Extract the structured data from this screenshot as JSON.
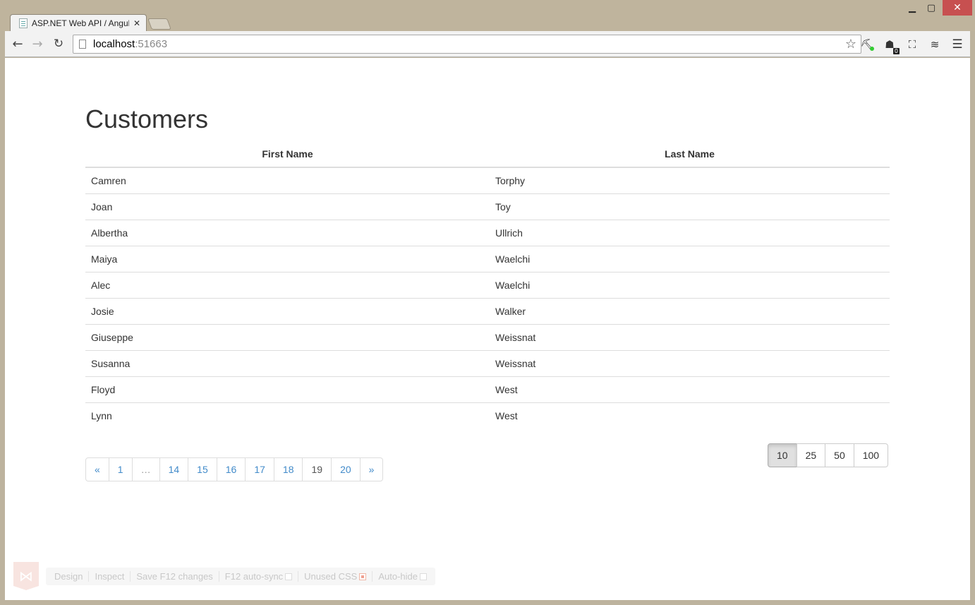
{
  "browser": {
    "tab_title": "ASP.NET Web API / Angul",
    "url_host": "localhost",
    "url_port": ":51663",
    "ext_badge": "0"
  },
  "page": {
    "title": "Customers",
    "columns": [
      "First Name",
      "Last Name"
    ],
    "rows": [
      {
        "first": "Camren",
        "last": "Torphy"
      },
      {
        "first": "Joan",
        "last": "Toy"
      },
      {
        "first": "Albertha",
        "last": "Ullrich"
      },
      {
        "first": "Maiya",
        "last": "Waelchi"
      },
      {
        "first": "Alec",
        "last": "Waelchi"
      },
      {
        "first": "Josie",
        "last": "Walker"
      },
      {
        "first": "Giuseppe",
        "last": "Weissnat"
      },
      {
        "first": "Susanna",
        "last": "Weissnat"
      },
      {
        "first": "Floyd",
        "last": "West"
      },
      {
        "first": "Lynn",
        "last": "West"
      }
    ],
    "pagination": {
      "prev": "«",
      "first": "1",
      "ellipsis": "…",
      "pages": [
        "14",
        "15",
        "16",
        "17",
        "18",
        "19",
        "20"
      ],
      "active": "19",
      "next": "»"
    },
    "page_sizes": [
      "10",
      "25",
      "50",
      "100"
    ],
    "selected_page_size": "10"
  },
  "browser_link": {
    "items": [
      "Design",
      "Inspect",
      "Save F12 changes",
      "F12 auto-sync",
      "Unused CSS",
      "Auto-hide"
    ]
  },
  "colors": {
    "link": "#428bca",
    "close_button": "#c75050"
  }
}
